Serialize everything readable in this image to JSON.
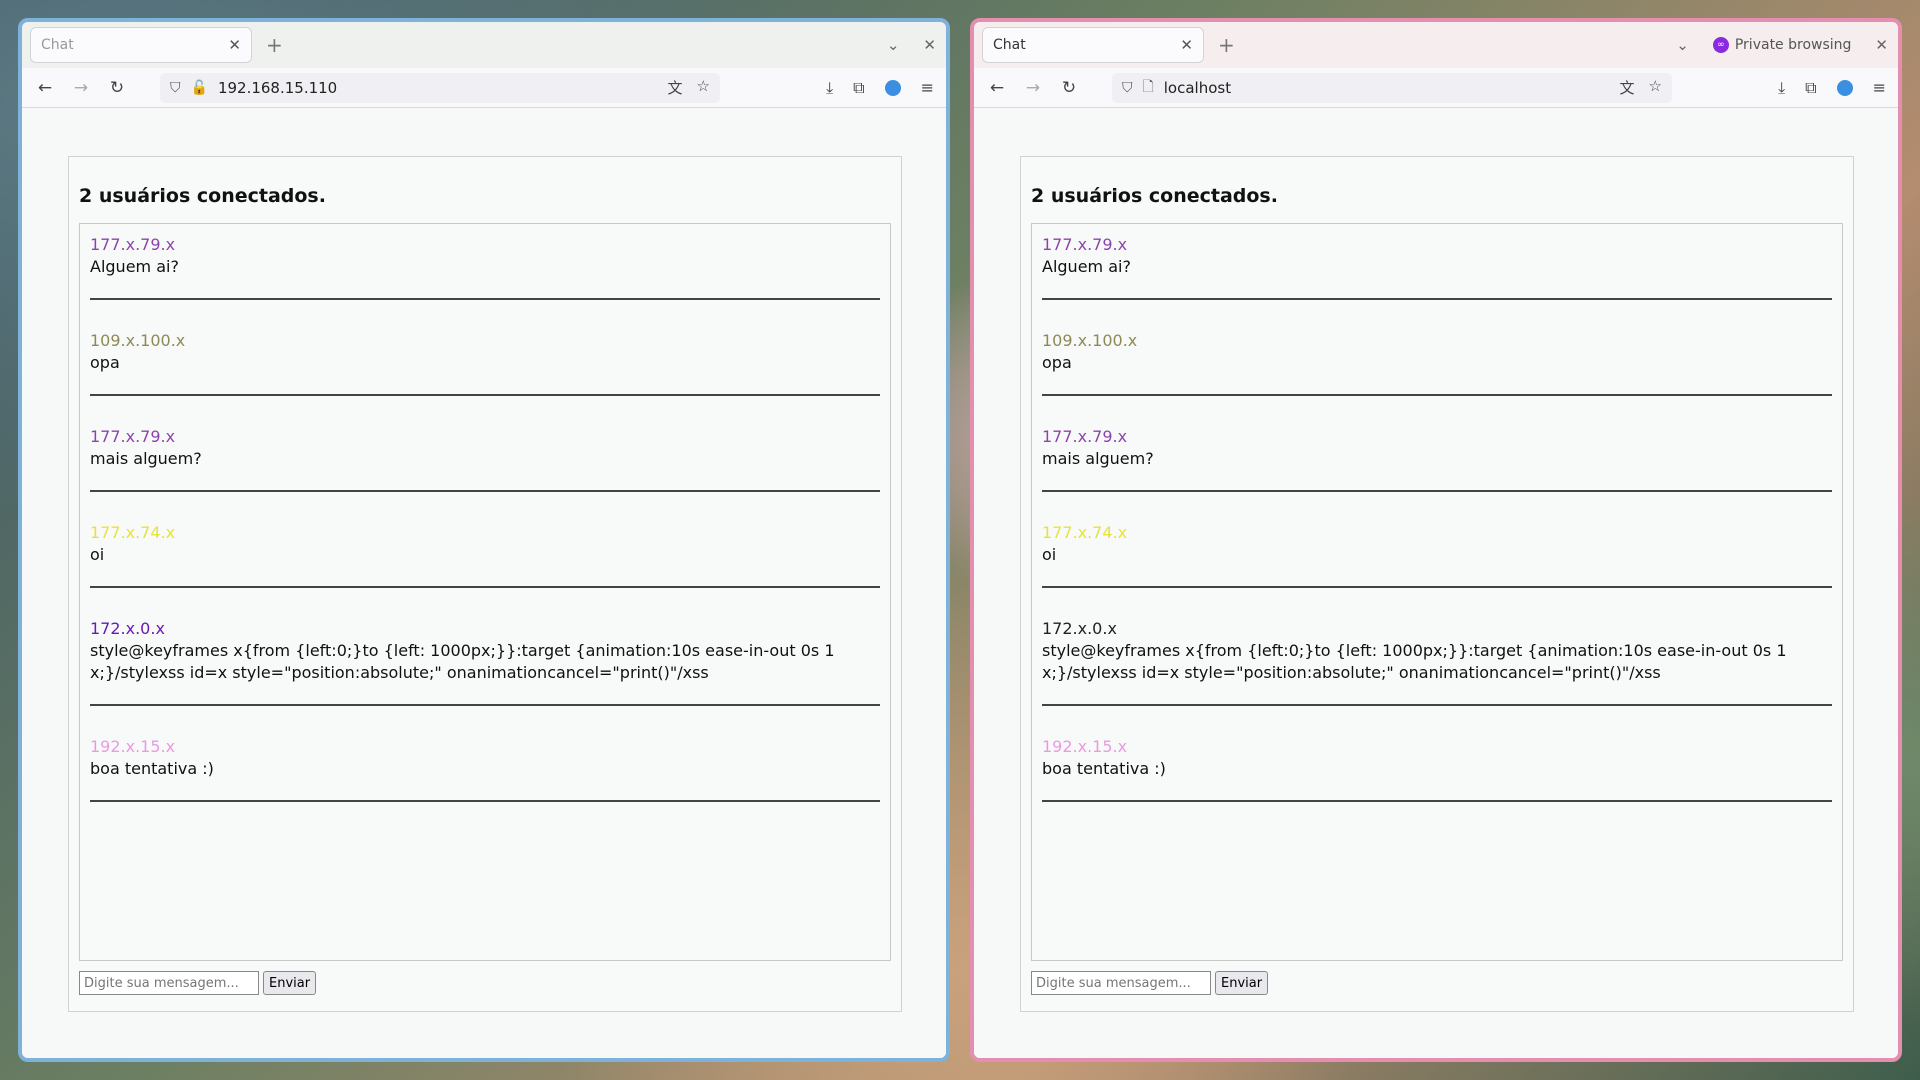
{
  "windows": [
    {
      "tab_title": "Chat",
      "url": "192.168.15.110",
      "private_label": "",
      "heading": "2 usuários conectados.",
      "messages": [
        {
          "user": "177.x.79.x",
          "color": "#8e44ad",
          "text": "Alguem ai?"
        },
        {
          "user": "109.x.100.x",
          "color": "#8f8a55",
          "text": "opa"
        },
        {
          "user": "177.x.79.x",
          "color": "#8e44ad",
          "text": "mais alguem?"
        },
        {
          "user": "177.x.74.x",
          "color": "#e7e33a",
          "text": "oi"
        },
        {
          "user": "172.x.0.x",
          "color": "#6a1bb5",
          "text": "style@keyframes x{from {left:0;}to {left: 1000px;}}:target {animation:10s ease-in-out 0s 1 x;}/stylexss id=x style=\"position:absolute;\" onanimationcancel=\"print()\"/xss"
        },
        {
          "user": "192.x.15.x",
          "color": "#e79be0",
          "text": "boa tentativa :)"
        }
      ],
      "input_placeholder": "Digite sua mensagem...",
      "send_label": "Enviar"
    },
    {
      "tab_title": "Chat",
      "url": "localhost",
      "private_label": "Private browsing",
      "heading": "2 usuários conectados.",
      "messages": [
        {
          "user": "177.x.79.x",
          "color": "#8e44ad",
          "text": "Alguem ai?"
        },
        {
          "user": "109.x.100.x",
          "color": "#8f8a55",
          "text": "opa"
        },
        {
          "user": "177.x.79.x",
          "color": "#8e44ad",
          "text": "mais alguem?"
        },
        {
          "user": "177.x.74.x",
          "color": "#e7e33a",
          "text": "oi"
        },
        {
          "user": "172.x.0.x",
          "color": "#222222",
          "text": "style@keyframes x{from {left:0;}to {left: 1000px;}}:target {animation:10s ease-in-out 0s 1 x;}/stylexss id=x style=\"position:absolute;\" onanimationcancel=\"print()\"/xss"
        },
        {
          "user": "192.x.15.x",
          "color": "#e79be0",
          "text": "boa tentativa :)"
        }
      ],
      "input_placeholder": "Digite sua mensagem...",
      "send_label": "Enviar"
    }
  ]
}
